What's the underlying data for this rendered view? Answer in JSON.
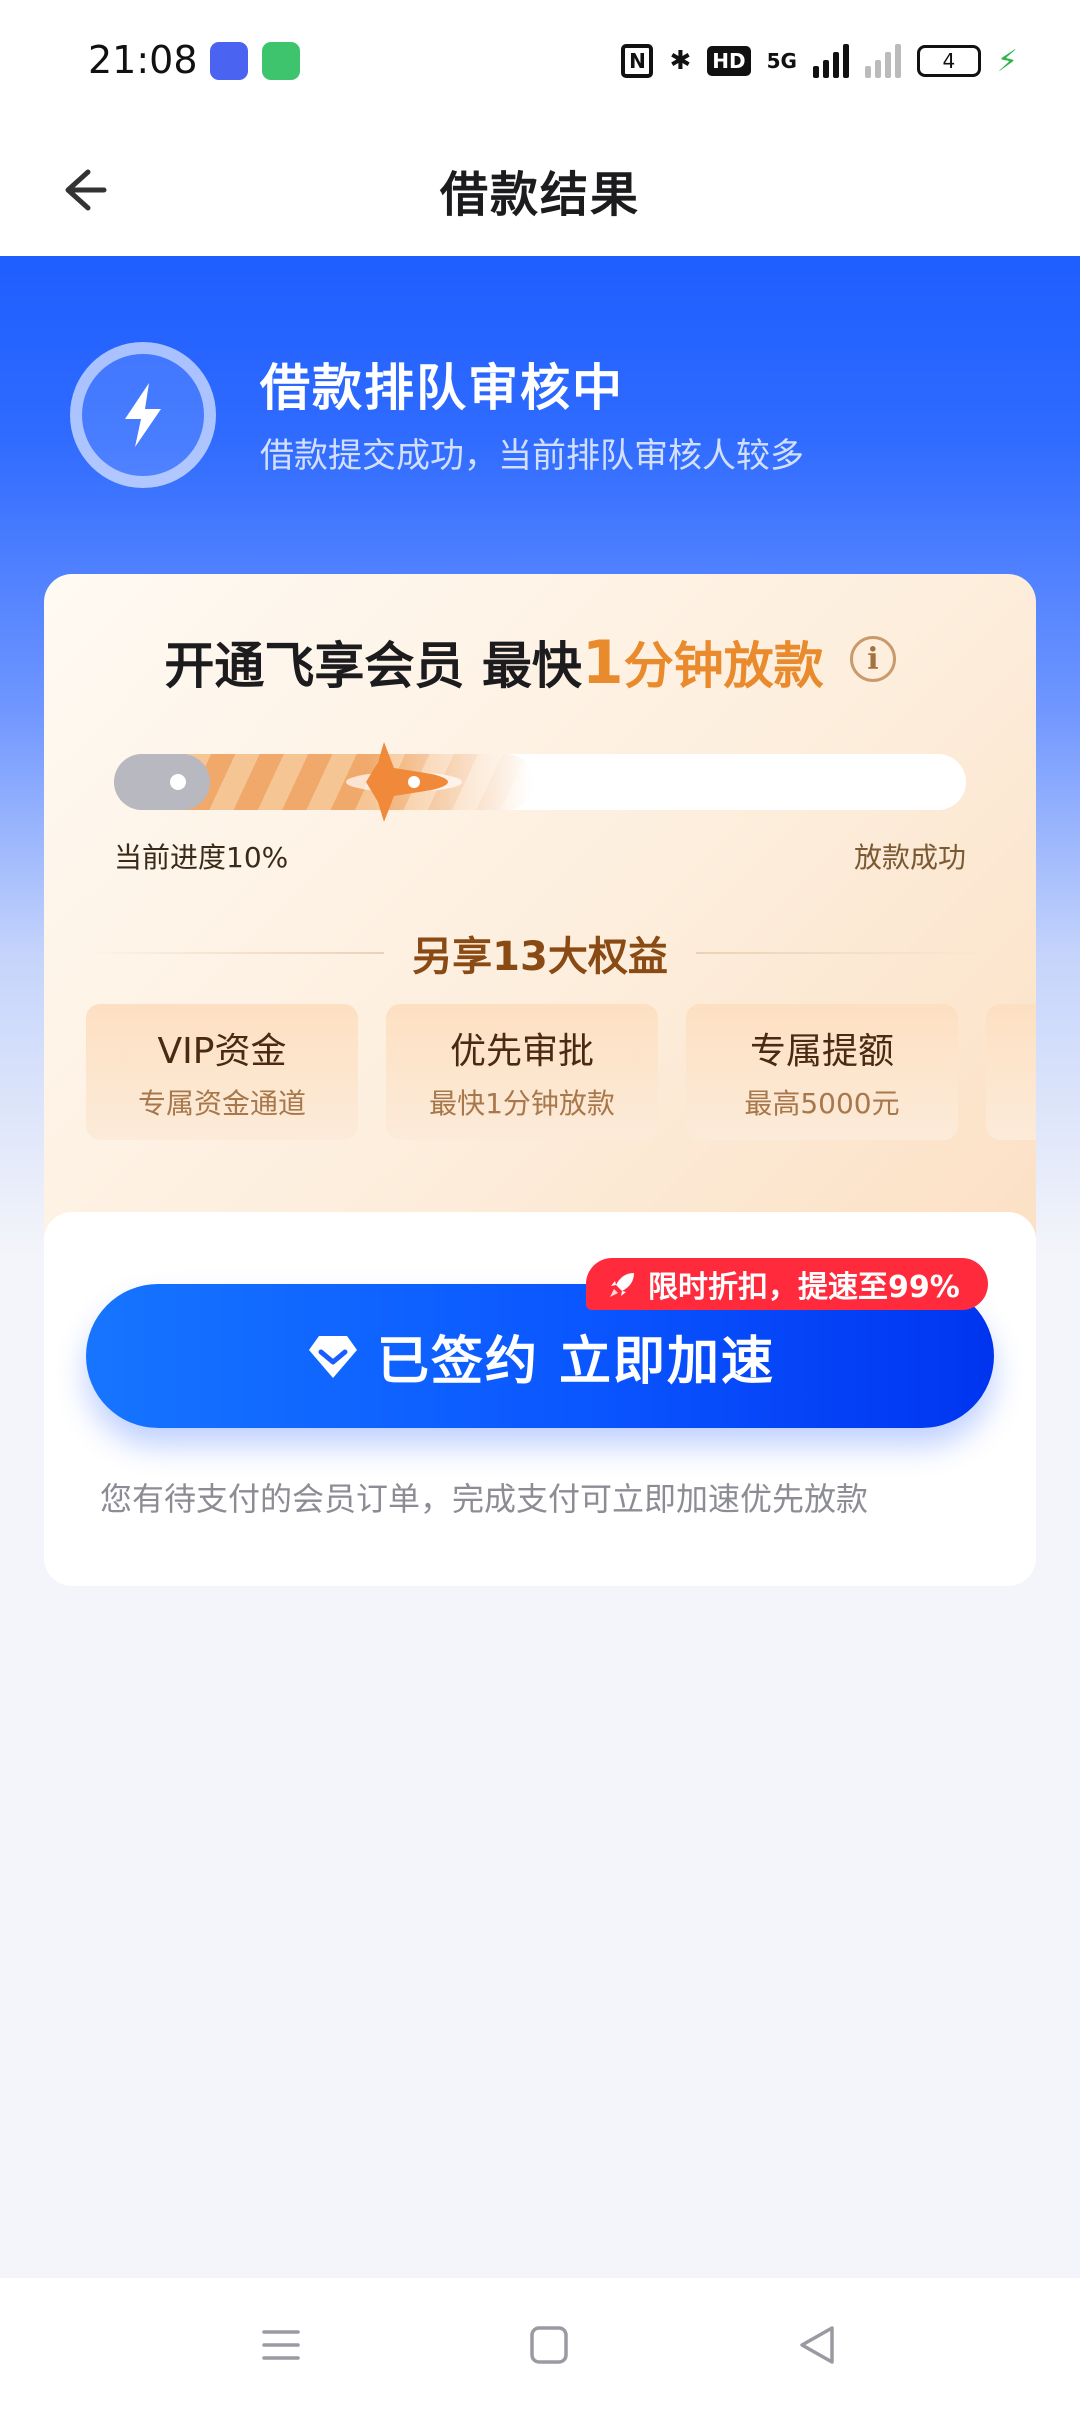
{
  "status_bar": {
    "time": "21:08",
    "battery": "4",
    "network": "5G",
    "hd": "HD"
  },
  "header": {
    "title": "借款结果",
    "back_icon": "arrow-left-icon"
  },
  "hero": {
    "title": "借款排队审核中",
    "subtitle": "借款提交成功，当前排队审核人较多",
    "icon": "lightning-icon"
  },
  "member_card": {
    "title_prefix": "开通飞享会员 最快",
    "title_highlight_num": "1",
    "title_highlight_rest": "分钟放款",
    "info_glyph": "i",
    "progress_fraction": 0.1,
    "progress_left_label": "当前进度10%",
    "progress_right_label": "放款成功",
    "benefits_heading": "另享13大权益",
    "benefits": [
      {
        "name": "VIP资金",
        "desc": "专属资金通道"
      },
      {
        "name": "优先审批",
        "desc": "最快1分钟放款"
      },
      {
        "name": "专属提额",
        "desc": "最高5000元"
      }
    ]
  },
  "action": {
    "badge": "限时折扣，提速至99%",
    "button_label": "已签约 立即加速",
    "note": "您有待支付的会员订单，完成支付可立即加速优先放款"
  },
  "colors": {
    "brand_blue": "#1f5eff",
    "accent_orange": "#e98a2c",
    "badge_red": "#ff2b3d"
  }
}
